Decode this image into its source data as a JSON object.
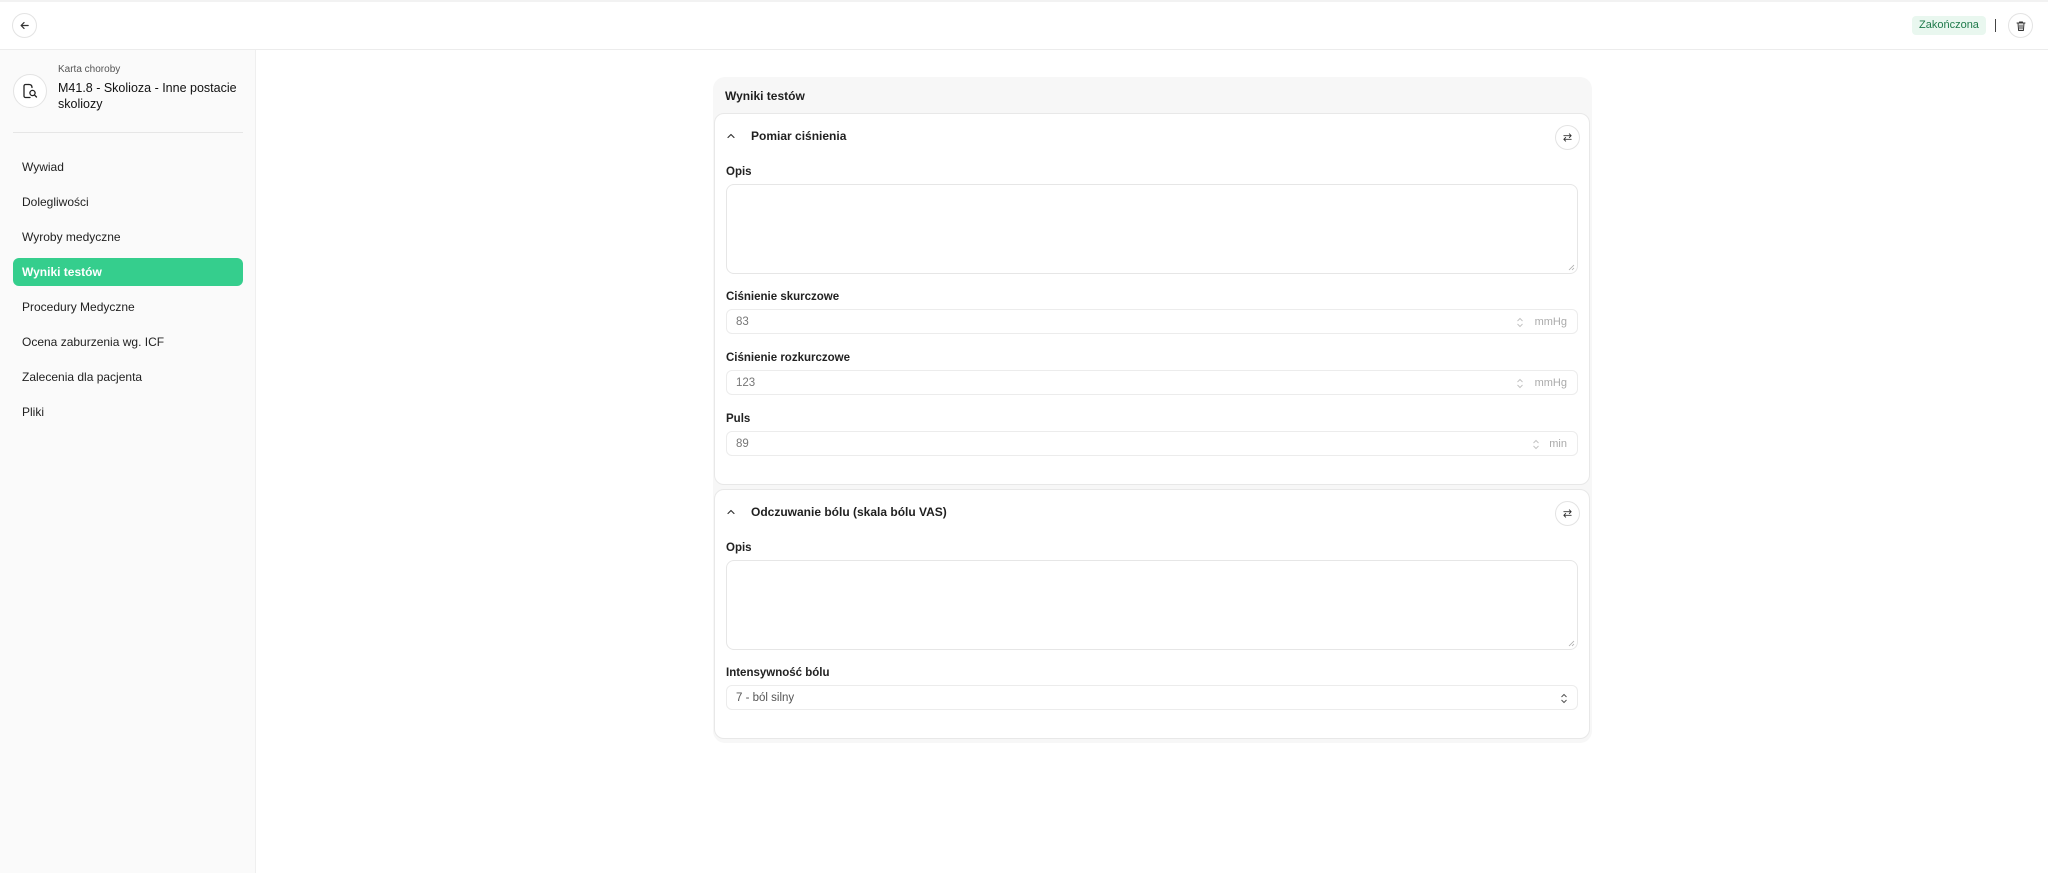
{
  "header": {
    "status_badge": "Zakończona"
  },
  "sidebar": {
    "card_kicker": "Karta choroby",
    "card_title": "M41.8 - Skolioza - Inne postacie skoliozy",
    "items": [
      {
        "label": "Wywiad",
        "active": false
      },
      {
        "label": "Dolegliwości",
        "active": false
      },
      {
        "label": "Wyroby medyczne",
        "active": false
      },
      {
        "label": "Wyniki testów",
        "active": true
      },
      {
        "label": "Procedury Medyczne",
        "active": false
      },
      {
        "label": "Ocena zaburzenia wg. ICF",
        "active": false
      },
      {
        "label": "Zalecenia dla pacjenta",
        "active": false
      },
      {
        "label": "Pliki",
        "active": false
      }
    ]
  },
  "main": {
    "title": "Wyniki testów",
    "blood_pressure": {
      "title": "Pomiar ciśnienia",
      "description_label": "Opis",
      "description_value": "",
      "systolic_label": "Ciśnienie skurczowe",
      "systolic_value": "83",
      "systolic_unit": "mmHg",
      "diastolic_label": "Ciśnienie rozkurczowe",
      "diastolic_value": "123",
      "diastolic_unit": "mmHg",
      "pulse_label": "Puls",
      "pulse_value": "89",
      "pulse_unit": "min"
    },
    "pain": {
      "title": "Odczuwanie bólu (skala bólu VAS)",
      "description_label": "Opis",
      "description_value": "",
      "intensity_label": "Intensywność bólu",
      "intensity_value": "7 - ból silny"
    }
  },
  "icons": {
    "back": "arrow-left-icon",
    "trash": "trash-icon",
    "disease": "medical-card-icon",
    "collapse": "chevron-up-icon",
    "swap": "swap-arrows-icon"
  },
  "colors": {
    "accent": "#35ce8d",
    "status_bg": "#e9f7ef",
    "status_text": "#1e7a4a"
  }
}
